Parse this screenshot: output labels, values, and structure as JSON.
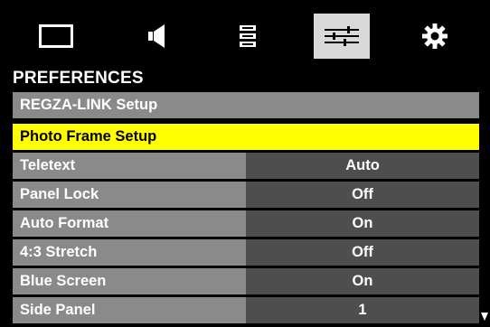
{
  "icon_tabs": [
    {
      "icon": "picture-icon",
      "active": false
    },
    {
      "icon": "sound-icon",
      "active": false
    },
    {
      "icon": "setup-icon",
      "active": false
    },
    {
      "icon": "preferences-icon",
      "active": true
    },
    {
      "icon": "settings-gear-icon",
      "active": false
    }
  ],
  "menu": {
    "title": "PREFERENCES",
    "items": [
      {
        "label": "REGZA-LINK Setup",
        "value": null,
        "selected": false
      },
      {
        "label": "Photo Frame Setup",
        "value": null,
        "selected": true
      },
      {
        "label": "Teletext",
        "value": "Auto",
        "selected": false
      },
      {
        "label": "Panel Lock",
        "value": "Off",
        "selected": false
      },
      {
        "label": "Auto Format",
        "value": "On",
        "selected": false
      },
      {
        "label": "4:3 Stretch",
        "value": "Off",
        "selected": false
      },
      {
        "label": "Blue Screen",
        "value": "On",
        "selected": false
      },
      {
        "label": "Side Panel",
        "value": "1",
        "selected": false
      }
    ]
  },
  "colors": {
    "highlight": "#ffff00",
    "label_bg": "#8a8a8a",
    "value_bg": "#4e4e4e",
    "active_tab_bg": "#d9d9d9"
  },
  "scroll_indicator": "down-arrow-icon"
}
